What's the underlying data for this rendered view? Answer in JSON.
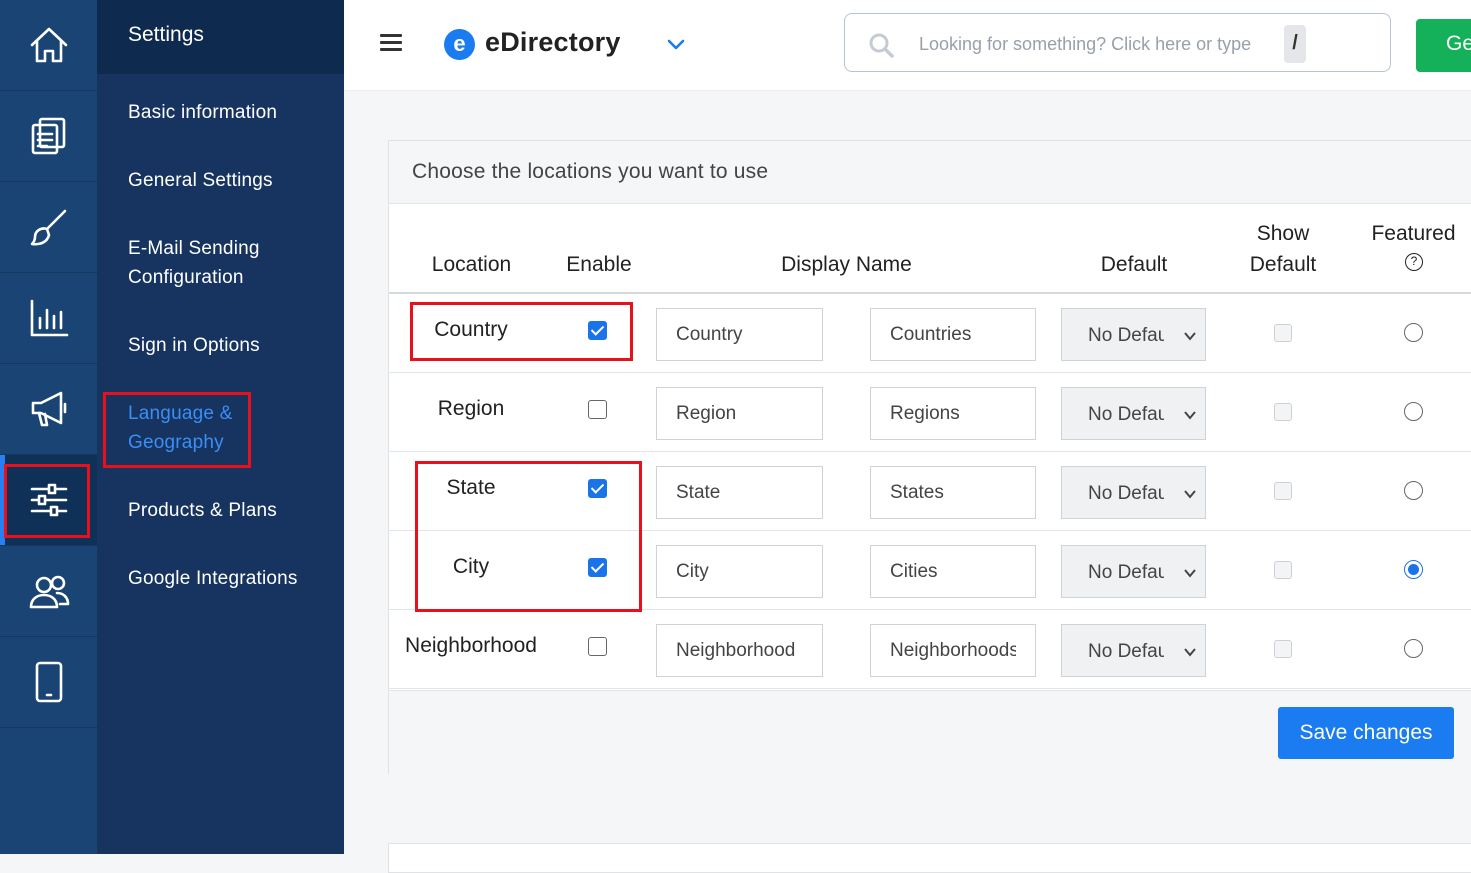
{
  "rail": {
    "items": [
      {
        "icon": "home-icon"
      },
      {
        "icon": "documents-icon"
      },
      {
        "icon": "brush-icon"
      },
      {
        "icon": "bar-chart-icon"
      },
      {
        "icon": "megaphone-icon"
      },
      {
        "icon": "sliders-icon",
        "active": true
      },
      {
        "icon": "users-icon"
      },
      {
        "icon": "mobile-icon"
      }
    ]
  },
  "sidebar": {
    "title": "Settings",
    "items": [
      {
        "label": "Basic information"
      },
      {
        "label": "General Settings"
      },
      {
        "label": "E-Mail Sending Configuration"
      },
      {
        "label": "Sign in Options"
      },
      {
        "label": "Language & Geography",
        "active": true
      },
      {
        "label": "Products & Plans"
      },
      {
        "label": "Google Integrations"
      }
    ]
  },
  "topbar": {
    "logo_letter": "e",
    "brand": "eDirectory",
    "search_placeholder": "Looking for something? Click here or type",
    "search_shortcut": "/",
    "action_button": "Ge"
  },
  "card": {
    "title": "Choose the locations you want to use",
    "columns": {
      "location": "Location",
      "enable": "Enable",
      "display_name": "Display Name",
      "default": "Default",
      "show_default": "Show Default",
      "featured": "Featured",
      "featured_help": "?"
    },
    "rows": [
      {
        "location": "Country",
        "enabled": true,
        "singular": "Country",
        "plural": "Countries",
        "default": "No Default",
        "featured": false
      },
      {
        "location": "Region",
        "enabled": false,
        "singular": "Region",
        "plural": "Regions",
        "default": "No Default",
        "featured": false
      },
      {
        "location": "State",
        "enabled": true,
        "singular": "State",
        "plural": "States",
        "default": "No Default",
        "featured": false
      },
      {
        "location": "City",
        "enabled": true,
        "singular": "City",
        "plural": "Cities",
        "default": "No Default",
        "featured": true
      },
      {
        "location": "Neighborhood",
        "enabled": false,
        "singular": "Neighborhood",
        "plural": "Neighborhoods",
        "default": "No Default",
        "featured": false
      }
    ],
    "save_label": "Save changes"
  },
  "colors": {
    "rail": "#1a4474",
    "sidebar": "#16345f",
    "accent": "#1a7cf0",
    "highlight": "#e8101a",
    "action_green": "#14b15a"
  }
}
